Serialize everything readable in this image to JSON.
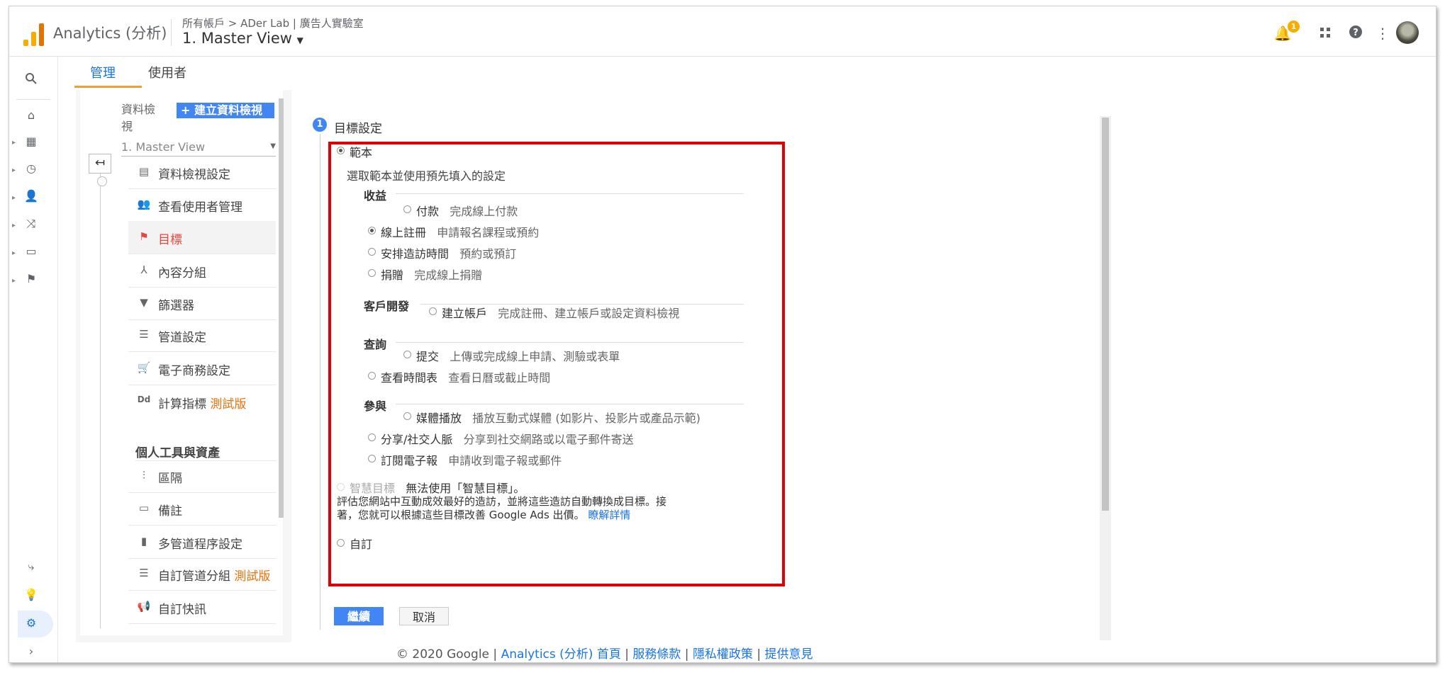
{
  "header": {
    "app_title": "Analytics (分析)",
    "breadcrumb": "所有帳戶 > ADer Lab | 廣告人實驗室",
    "view_title": "1. Master View",
    "notification_count": "1"
  },
  "tabs": [
    {
      "label": "管理"
    },
    {
      "label": "使用者"
    }
  ],
  "nav": {
    "view_label": "資料檢視",
    "create_button": "+ 建立資料檢視",
    "selected_view": "1. Master View",
    "items": [
      {
        "label": "資料檢視設定"
      },
      {
        "label": "查看使用者管理"
      },
      {
        "label": "目標"
      },
      {
        "label": "內容分組"
      },
      {
        "label": "篩選器"
      },
      {
        "label": "管道設定"
      },
      {
        "label": "電子商務設定"
      },
      {
        "label": "計算指標",
        "badge": "測試版"
      }
    ],
    "section_title": "個人工具與資產",
    "items2": [
      {
        "label": "區隔"
      },
      {
        "label": "備註"
      },
      {
        "label": "多管道程序設定"
      },
      {
        "label": "自訂管道分組",
        "badge": "測試版"
      },
      {
        "label": "自訂快訊"
      }
    ]
  },
  "goal": {
    "step_number": "1",
    "step_title": "目標設定",
    "template_label": "範本",
    "template_desc": "選取範本並使用預先填入的設定",
    "categories": [
      {
        "title": "收益",
        "options": [
          {
            "name": "付款",
            "desc": "完成線上付款"
          },
          {
            "name": "線上註冊",
            "desc": "申請報名課程或預約"
          },
          {
            "name": "安排造訪時間",
            "desc": "預約或預訂"
          },
          {
            "name": "捐贈",
            "desc": "完成線上捐贈"
          }
        ]
      },
      {
        "title": "客戶開發",
        "options": [
          {
            "name": "建立帳戶",
            "desc": "完成註冊、建立帳戶或設定資料檢視"
          }
        ]
      },
      {
        "title": "查詢",
        "options": [
          {
            "name": "提交",
            "desc": "上傳或完成線上申請、測驗或表單"
          },
          {
            "name": "查看時間表",
            "desc": "查看日曆或截止時間"
          }
        ]
      },
      {
        "title": "參與",
        "options": [
          {
            "name": "媒體播放",
            "desc": "播放互動式媒體 (如影片、投影片或產品示範)"
          },
          {
            "name": "分享/社交人脈",
            "desc": "分享到社交網路或以電子郵件寄送"
          },
          {
            "name": "訂閱電子報",
            "desc": "申請收到電子報或郵件"
          }
        ]
      }
    ],
    "smart_label": "智慧目標",
    "smart_unavailable": "無法使用「智慧目標」。",
    "smart_desc_1": "評估您網站中互動成效最好的造訪，並將這些造訪自動轉換成目標。接",
    "smart_desc_2": "著，您就可以根據這些目標改善 Google Ads 出價。",
    "learn_more": "瞭解詳情",
    "custom_label": "自訂",
    "continue_button": "繼續",
    "cancel_button": "取消"
  },
  "footer": {
    "copyright": "© 2020 Google | ",
    "home": "Analytics (分析) 首頁",
    "sep": " | ",
    "terms": "服務條款",
    "privacy": "隱私權政策",
    "feedback": "提供意見"
  },
  "colors": {
    "accent_blue": "#4285f4",
    "active_red": "#e8453c",
    "highlight_box": "#e00000",
    "beta_orange": "#e8710a",
    "logo_orange": "#f9ab00"
  }
}
